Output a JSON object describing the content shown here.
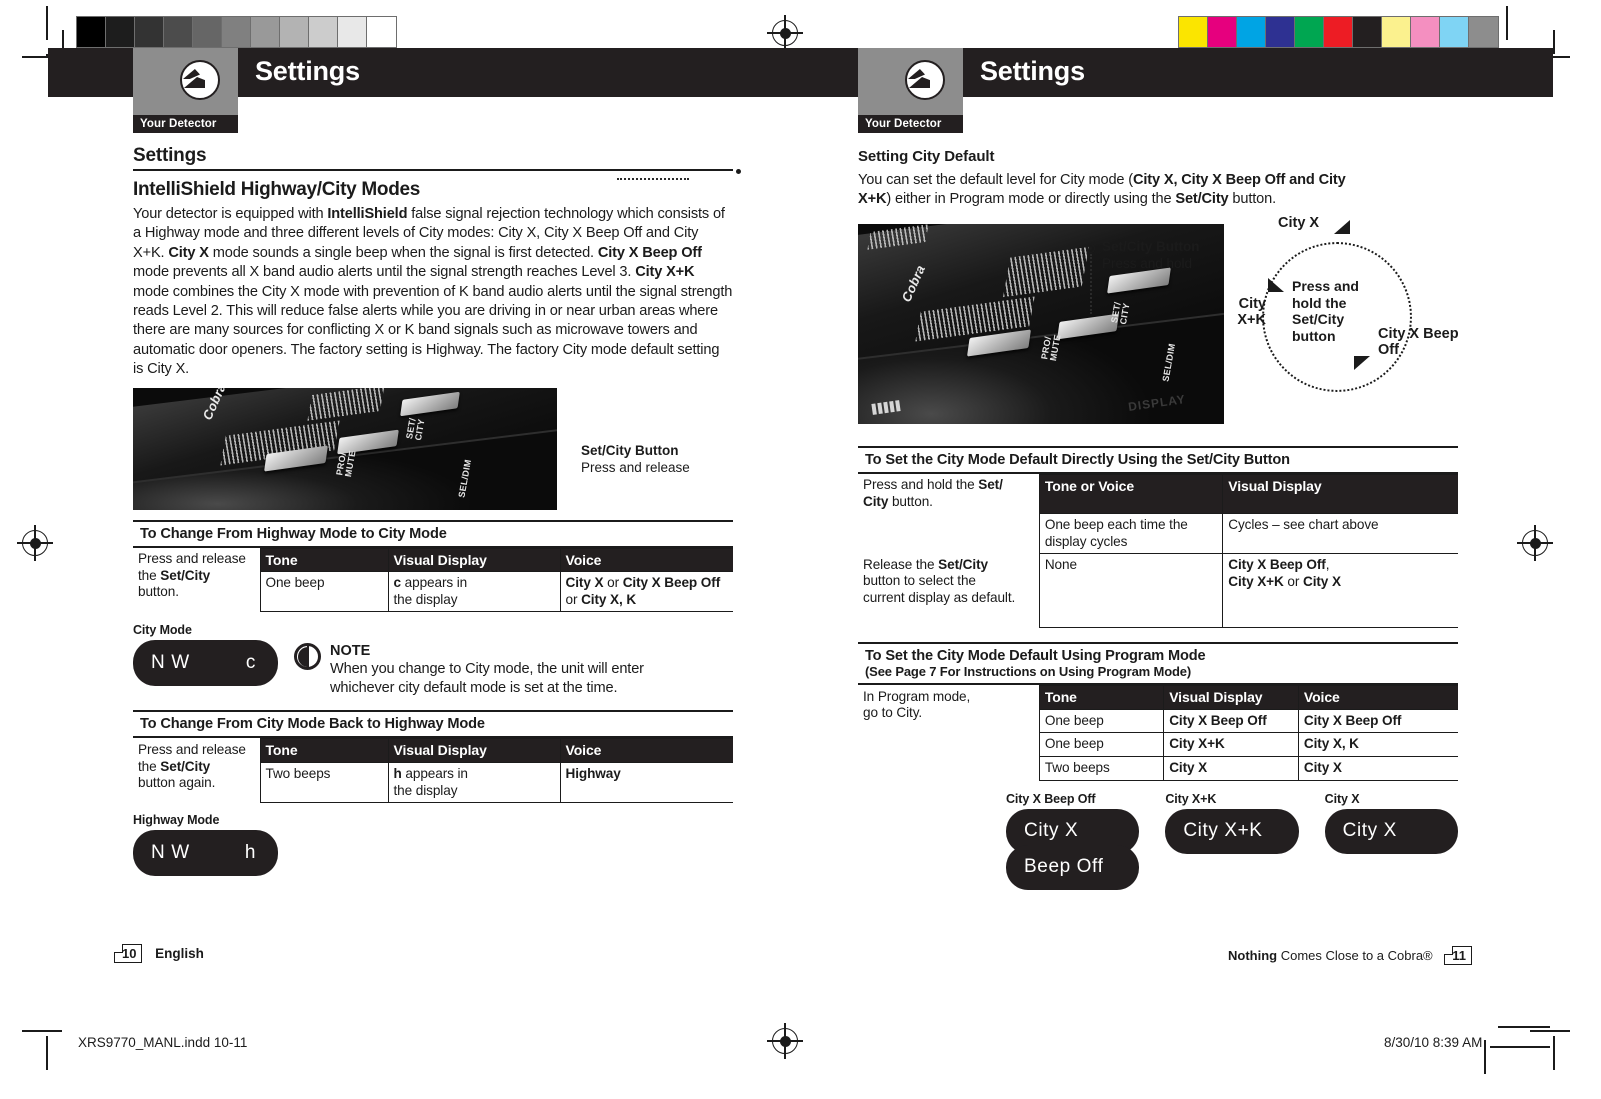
{
  "sheet": {
    "slug_left": "XRS9770_MANL.indd   10-11",
    "slug_right": "8/30/10   8:39 AM",
    "gray_steps": [
      "#000000",
      "#1d1d1d",
      "#333333",
      "#4c4c4c",
      "#666666",
      "#808080",
      "#999999",
      "#b3b3b3",
      "#cccccc",
      "#e8e8e8",
      "#ffffff"
    ],
    "color_steps": [
      "#fbe500",
      "#e6007e",
      "#00a4e4",
      "#2e3192",
      "#00a651",
      "#ed1c24",
      "#231f20",
      "#fbf18e",
      "#f48fc0",
      "#7fd4f4",
      "#8d8d8d"
    ]
  },
  "left_page": {
    "header": {
      "tab": "Your Detector",
      "title": "Settings",
      "logo": "cobra-logo"
    },
    "section_title": "Settings",
    "heading": "IntelliShield Highway/City Modes",
    "intro": "Your detector is equipped with IntelliShield false signal rejection technology which consists of a Highway mode and three different levels of City modes: City X, City X Beep Off and City X+K. City X mode sounds a single beep when the signal is first detected. City X Beep Off mode prevents all X band audio alerts until the signal strength reaches Level 3. City X+K mode combines the City X mode with prevention of K band audio alerts until the signal strength reads Level 2. This will reduce false alerts while you are driving in or near urban areas where there are many sources for conflicting X or K band signals such as microwave towers and automatic door openers. The factory setting is Highway. The factory City mode default setting is City X.",
    "photo": {
      "logo": "Cobra",
      "key_labels": [
        "PRO/\nMUTE",
        "SET/\nCITY",
        "SEL/DIM"
      ]
    },
    "callout": {
      "title": "Set/City Button",
      "sub": "Press and release"
    },
    "table1": {
      "caption": "To Change From Highway Mode to City Mode",
      "first_cell": "Press and release the Set/City button.",
      "headers": [
        "Tone",
        "Visual Display",
        "Voice"
      ],
      "rows": [
        [
          "One beep",
          "c appears in the display",
          "City X or City X Beep Off or City X, K"
        ]
      ]
    },
    "lcd1": {
      "label": "City Mode",
      "left": "N W",
      "right": "c"
    },
    "note": {
      "title": "NOTE",
      "body": "When you change to City mode, the unit will enter whichever city default mode is set at the time."
    },
    "table2": {
      "caption": "To Change From City Mode Back to Highway Mode",
      "first_cell": "Press and release the Set/City button again.",
      "headers": [
        "Tone",
        "Visual Display",
        "Voice"
      ],
      "rows": [
        [
          "Two beeps",
          "h appears in the display",
          "Highway"
        ]
      ]
    },
    "lcd2": {
      "label": "Highway Mode",
      "left": "N W",
      "right": "h"
    },
    "footer": {
      "page": "10",
      "language": "English"
    }
  },
  "right_page": {
    "header": {
      "tab": "Your Detector",
      "title": "Settings",
      "logo": "cobra-logo"
    },
    "heading": "Setting City Default",
    "intro": "You can set the default level for City mode (City X, City X Beep Off and City X+K) either in Program mode or directly using the Set/City button.",
    "photo": {
      "logo": "Cobra",
      "key_labels": [
        "PRO/\nMUTE",
        "SET/\nCITY",
        "SEL/DIM"
      ],
      "display_text": "DISPLAY"
    },
    "callout": {
      "title": "Set/City Button",
      "sub": "Press and hold"
    },
    "cycle": {
      "center": "Press and hold the Set/City button",
      "nodes": [
        "City X",
        "City X Beep Off",
        "City X+K"
      ]
    },
    "table1": {
      "caption": "To Set the City Mode Default Directly Using the Set/City Button",
      "headers": [
        "Tone or Voice",
        "Visual Display"
      ],
      "rows": [
        {
          "first": "Press and hold the Set/City button.",
          "cells": [
            "One beep each time the display cycles",
            "Cycles – see chart above"
          ]
        },
        {
          "first": "Release the Set/City button to select the current display as default.",
          "cells": [
            "None",
            "City X Beep Off, City X+K or City X"
          ]
        }
      ]
    },
    "table2": {
      "caption": "To Set the City Mode Default Using Program Mode",
      "caption_sub": "(See Page 7 For Instructions on Using Program Mode)",
      "first_cell": "In Program mode, go to City.",
      "headers": [
        "Tone",
        "Visual Display",
        "Voice"
      ],
      "rows": [
        [
          "One beep",
          "City X Beep Off",
          "City X Beep Off"
        ],
        [
          "One beep",
          "City X+K",
          "City X, K"
        ],
        [
          "Two beeps",
          "City X",
          "City X"
        ]
      ]
    },
    "lcds": [
      {
        "label": "City X Beep Off",
        "line1": "City X",
        "line2": "Beep Off"
      },
      {
        "label": "City X+K",
        "line1": "City X+K",
        "line2": ""
      },
      {
        "label": "City X",
        "line1": "City X",
        "line2": ""
      }
    ],
    "footer": {
      "page": "11",
      "tagline_bold": "Nothing",
      "tagline_rest": " Comes Close to a Cobra®"
    }
  }
}
